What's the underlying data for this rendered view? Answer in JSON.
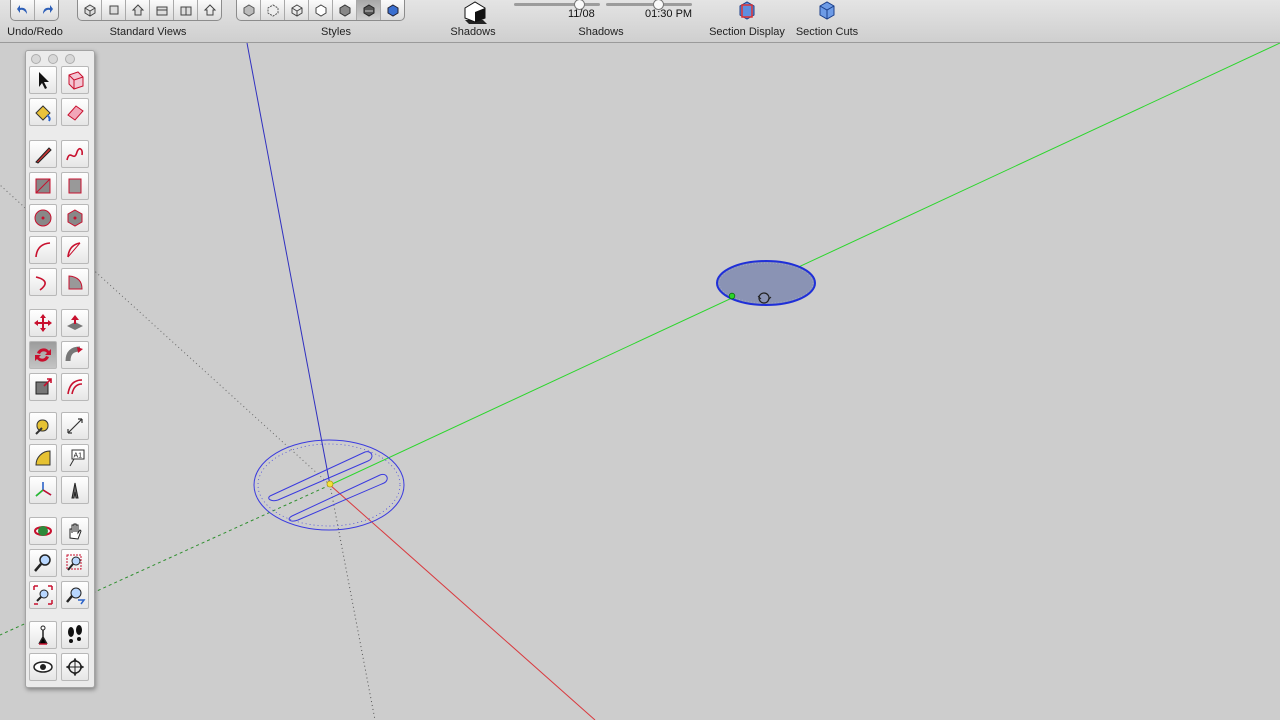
{
  "toolbar": {
    "undo_redo_label": "Undo/Redo",
    "standard_views_label": "Standard Views",
    "styles_label": "Styles",
    "shadows_label_1": "Shadows",
    "shadows_label_2": "Shadows",
    "section_display_label": "Section Display",
    "section_cuts_label": "Section Cuts",
    "shadow_date": "11/08",
    "shadow_time": "01:30 PM",
    "shadow_date_fraction": 0.75,
    "shadow_time_fraction": 0.6
  },
  "palette": {
    "tools": [
      "select-tool",
      "make-component-tool",
      "paint-bucket-tool",
      "eraser-tool",
      "pencil-line-tool",
      "freehand-tool",
      "rectangle-tool",
      "rotated-rectangle-tool",
      "circle-tool",
      "polygon-tool",
      "arc-tool",
      "pie-tool",
      "three-point-arc-tool",
      "two-point-arc-tool",
      "move-tool",
      "push-pull-tool",
      "rotate-tool",
      "follow-me-tool",
      "scale-tool",
      "offset-tool",
      "tape-measure-tool",
      "dimension-tool",
      "protractor-tool",
      "text-tool",
      "axes-tool",
      "3d-text-tool",
      "orbit-tool",
      "pan-tool",
      "zoom-tool",
      "zoom-window-tool",
      "zoom-extents-tool",
      "previous-view-tool",
      "position-camera-tool",
      "walk-tool",
      "look-around-tool",
      "section-plane-tool"
    ],
    "active_tool": "rotate-tool"
  },
  "colors": {
    "red_axis": "#d9393e",
    "green_axis": "#2bd62b",
    "blue_axis": "#3030c0",
    "protractor": "#3a3adf",
    "selected_face": "#8a93b4",
    "background": "#cdcdcd"
  }
}
